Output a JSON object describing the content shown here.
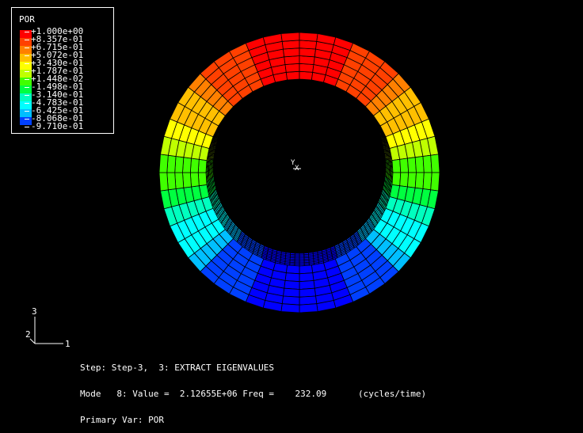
{
  "legend": {
    "title": "POR",
    "entries": [
      {
        "label": "+1.000e+00",
        "color": "#ff0000"
      },
      {
        "label": "+8.357e-01",
        "color": "#ff4000"
      },
      {
        "label": "+6.715e-01",
        "color": "#ff8000"
      },
      {
        "label": "+5.072e-01",
        "color": "#ffbf00"
      },
      {
        "label": "+3.430e-01",
        "color": "#ffff00"
      },
      {
        "label": "+1.787e-01",
        "color": "#bfff00"
      },
      {
        "label": "+1.448e-02",
        "color": "#40ff00"
      },
      {
        "label": "-1.498e-01",
        "color": "#00ff40"
      },
      {
        "label": "-3.140e-01",
        "color": "#00ffbf"
      },
      {
        "label": "-4.783e-01",
        "color": "#00ffff"
      },
      {
        "label": "-6.425e-01",
        "color": "#00bfff"
      },
      {
        "label": "-8.068e-01",
        "color": "#0040ff"
      },
      {
        "label": "-9.710e-01",
        "color": "#0000ff"
      }
    ]
  },
  "triad": {
    "axis3": "3",
    "axis2": "2",
    "axis1": "1"
  },
  "status": {
    "line1": "Step: Step-3,  3: EXTRACT EIGENVALUES",
    "line2": "Mode   8: Value =  2.12655E+06 Freq =    232.09      (cycles/time)",
    "line3": "Primary Var: POR"
  },
  "center_triad": {
    "y": "Y",
    "x": "X"
  },
  "colors": {
    "background": "#000000",
    "mesh_line": "#000000",
    "text": "#ffffff"
  }
}
